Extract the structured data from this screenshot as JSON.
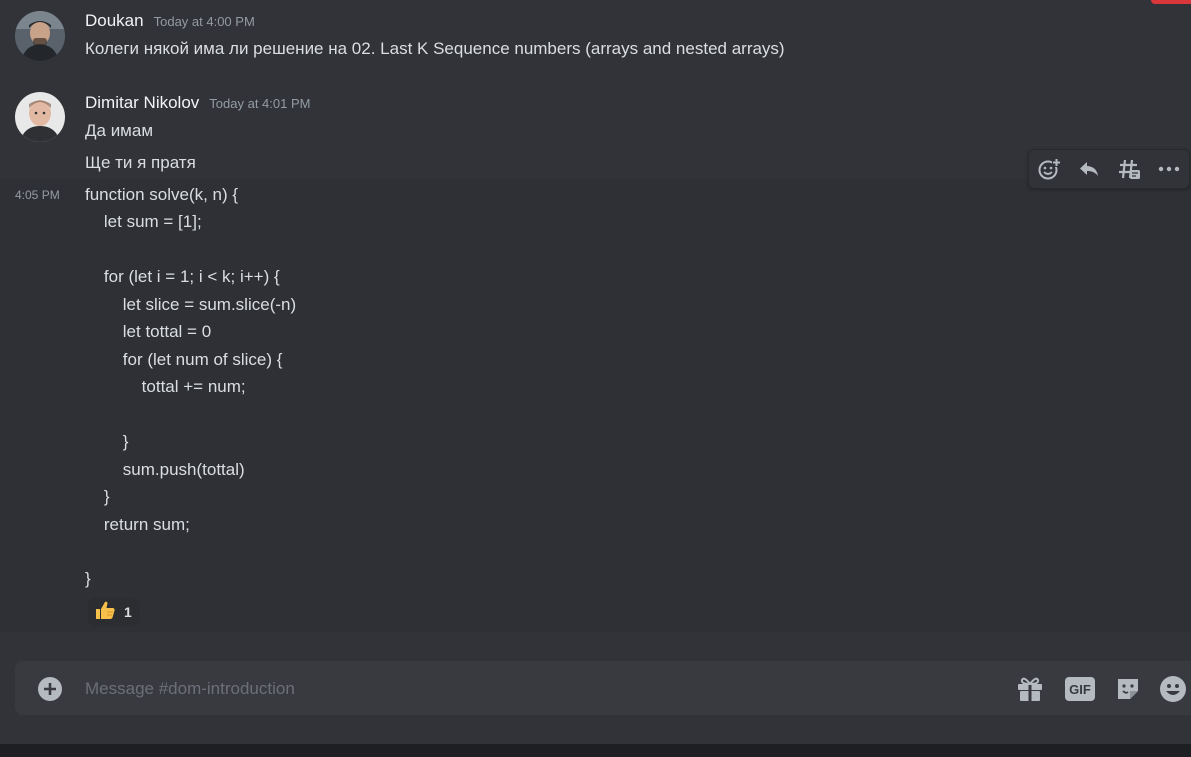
{
  "channel": {
    "name": "dom-introduction"
  },
  "messages": [
    {
      "author": "Doukan",
      "timestamp": "Today at 4:00 PM",
      "text": "Колеги някой има ли решение на 02. Last K Sequence numbers (arrays and nested arrays)"
    },
    {
      "author": "Dimitar Nikolov",
      "timestamp": "Today at 4:01 PM",
      "lines": [
        "Да имам",
        "Ще ти я пратя"
      ]
    },
    {
      "side_time": "4:05 PM",
      "code": [
        "function solve(k, n) {",
        "    let sum = [1];",
        "",
        "    for (let i = 1; i < k; i++) {",
        "        let slice = sum.slice(-n)",
        "        let tottal = 0",
        "        for (let num of slice) {",
        "            tottal += num;",
        "",
        "        }",
        "        sum.push(tottal)",
        "    }",
        "    return sum;",
        "",
        "}"
      ],
      "reaction": {
        "emoji": "thumbs-up",
        "count": "1"
      }
    }
  ],
  "toolbar": {
    "icons": [
      "add-reaction-icon",
      "reply-icon",
      "create-thread-icon",
      "more-icon"
    ]
  },
  "composer": {
    "placeholder": "Message #dom-introduction",
    "gif_label": "GIF",
    "icons": [
      "add-attachment-icon",
      "gift-icon",
      "gif-icon",
      "sticker-icon",
      "emoji-icon"
    ]
  },
  "colors": {
    "background": "#313338",
    "hover_background": "#2e3035",
    "composer_background": "#383a40",
    "muted_text": "#949ba4",
    "alert": "#da373c"
  }
}
